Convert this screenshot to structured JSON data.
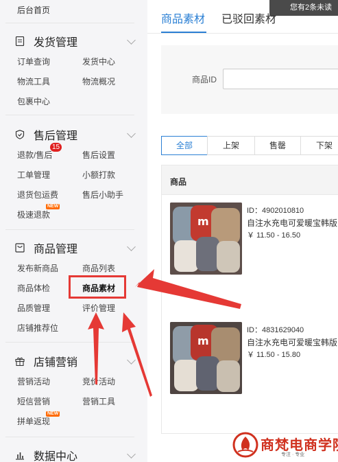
{
  "sidebar": {
    "home": "后台首页",
    "sections": [
      {
        "title": "发货管理",
        "icon": "document-icon",
        "items": [
          "订单查询",
          "发货中心",
          "物流工具",
          "物流概况",
          "包裹中心"
        ]
      },
      {
        "title": "售后管理",
        "icon": "shield-icon",
        "items": [
          "退款/售后",
          "售后设置",
          "工单管理",
          "小额打款",
          "退货包运费",
          "售后小助手",
          "极速退款"
        ],
        "badge": "15",
        "new_tag": "NEW"
      },
      {
        "title": "商品管理",
        "icon": "bag-icon",
        "items": [
          "发布新商品",
          "商品列表",
          "商品体检",
          "商品素材",
          "品质管理",
          "评价管理",
          "店铺推荐位"
        ]
      },
      {
        "title": "店铺营销",
        "icon": "gift-icon",
        "items": [
          "营销活动",
          "竞价活动",
          "短信营销",
          "营销工具",
          "拼单返现"
        ],
        "new_tag": "NEW"
      },
      {
        "title": "数据中心",
        "icon": "bar-chart-icon"
      }
    ]
  },
  "tabs": [
    "商品素材",
    "已驳回素材"
  ],
  "notice": "您有2条未读",
  "filter": {
    "label": "商品ID"
  },
  "status_segments": [
    "全部",
    "上架",
    "售罄",
    "下架"
  ],
  "table": {
    "header": "商品"
  },
  "products": [
    {
      "id": "ID：4902010810",
      "name": "自注水充电可爱暖宝韩版",
      "price": "￥ 11.50 - 16.50"
    },
    {
      "id": "ID：4831629040",
      "name": "自注水充电可爱暖宝韩版",
      "price": "￥ 11.50 - 15.80"
    }
  ],
  "watermark": {
    "name": "商梵电商学院",
    "slogan": "专注 · 专业"
  },
  "colors": {
    "accent": "#2a7fd4",
    "highlight": "#e53935",
    "badge": "#e02020"
  }
}
